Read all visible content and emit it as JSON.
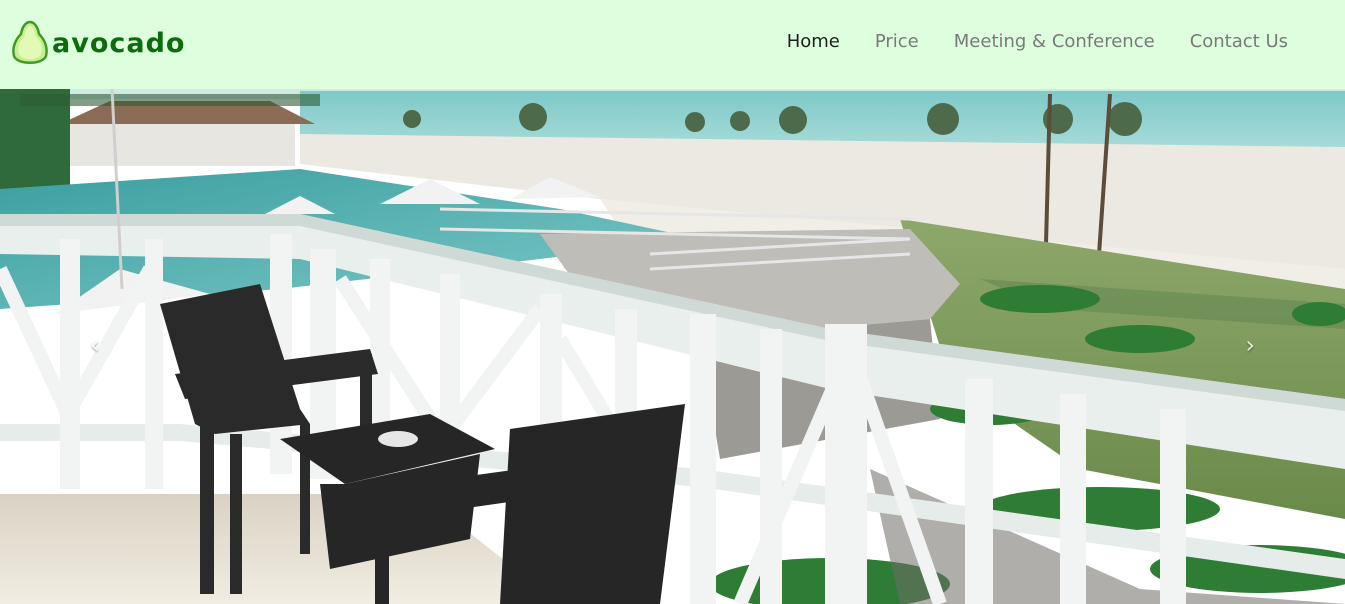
{
  "brand": {
    "name": "avocado",
    "icon": "avocado-icon",
    "color": "#0d6b0d"
  },
  "nav": {
    "items": [
      {
        "label": "Home",
        "active": true
      },
      {
        "label": "Price",
        "active": false
      },
      {
        "label": "Meeting & Conference",
        "active": false
      },
      {
        "label": "Contact Us",
        "active": false
      }
    ]
  },
  "carousel": {
    "image_alt": "Hotel balcony with rattan chairs overlooking pool and beach",
    "prev_icon": "chevron-left-icon",
    "next_icon": "chevron-right-icon",
    "prev_glyph": "‹",
    "next_glyph": "›"
  },
  "colors": {
    "navbar_bg": "#ddffdd",
    "nav_active": "#1f1f1f",
    "nav_inactive": "#7a7a7a"
  }
}
